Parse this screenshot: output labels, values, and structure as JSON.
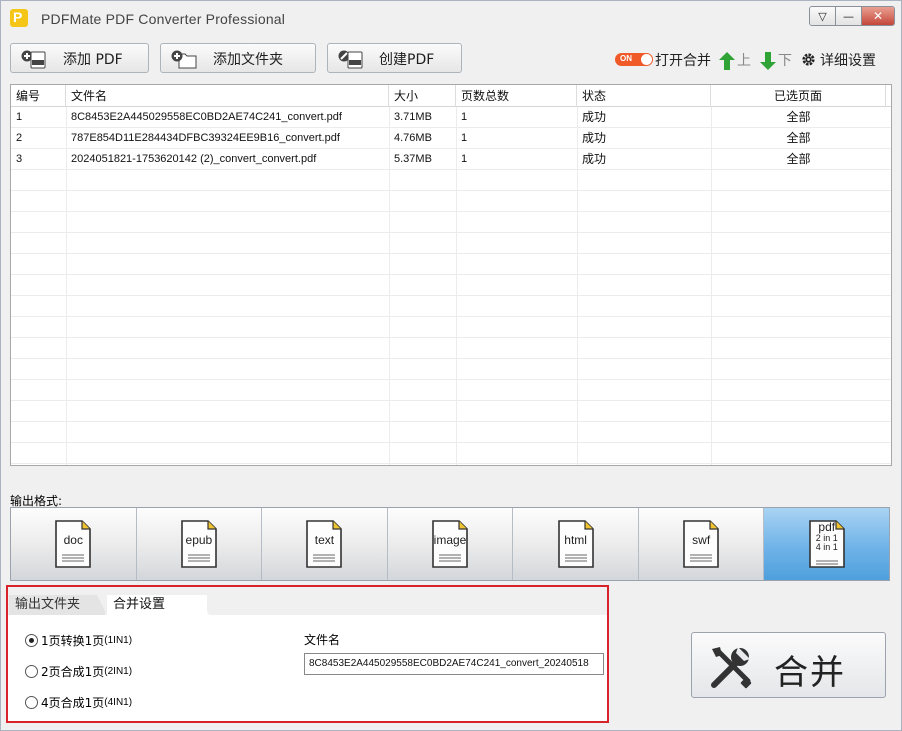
{
  "window": {
    "title": "PDFMate PDF Converter Professional",
    "controls": {
      "dropdown": "▽",
      "minimize": "—",
      "close": "✕"
    }
  },
  "toolbar": {
    "add_pdf": "添加 PDF",
    "add_folder": "添加文件夹",
    "create_pdf": "创建PDF",
    "toggle_text": "ON",
    "open_merge": "打开合并",
    "up": "上",
    "down": "下",
    "settings": "详细设置"
  },
  "table": {
    "columns": [
      "编号",
      "文件名",
      "大小",
      "页数总数",
      "状态",
      "已选页面"
    ],
    "rows": [
      {
        "id": "1",
        "name": "8C8453E2A445029558EC0BD2AE74C241_convert.pdf",
        "size": "3.71MB",
        "pages": "1",
        "status": "成功",
        "selected": "全部"
      },
      {
        "id": "2",
        "name": "787E854D11E284434DFBC39324EE9B16_convert.pdf",
        "size": "4.76MB",
        "pages": "1",
        "status": "成功",
        "selected": "全部"
      },
      {
        "id": "3",
        "name": "2024051821-1753620142 (2)_convert_convert.pdf",
        "size": "5.37MB",
        "pages": "1",
        "status": "成功",
        "selected": "全部"
      }
    ]
  },
  "output": {
    "label": "输出格式:",
    "formats": [
      {
        "key": "doc",
        "label": "doc"
      },
      {
        "key": "epub",
        "label": "epub"
      },
      {
        "key": "text",
        "label": "text"
      },
      {
        "key": "image",
        "label": "image"
      },
      {
        "key": "html",
        "label": "html"
      },
      {
        "key": "swf",
        "label": "swf"
      },
      {
        "key": "pdf",
        "label": "pdf",
        "sub1": "2 in 1",
        "sub2": "4 in 1"
      }
    ],
    "selected": "pdf"
  },
  "settings": {
    "tabs": [
      "输出文件夹",
      "合并设置"
    ],
    "active_tab": "合并设置",
    "options": [
      {
        "main": "1页转换1页",
        "suffix": "(1IN1)",
        "checked": true
      },
      {
        "main": "2页合成1页",
        "suffix": "(2IN1)",
        "checked": false
      },
      {
        "main": "4页合成1页",
        "suffix": "(4IN1)",
        "checked": false
      }
    ],
    "filename_label": "文件名",
    "filename_value": "8C8453E2A445029558EC0BD2AE74C241_convert_20240518"
  },
  "merge_button": {
    "label": "合并"
  },
  "colors": {
    "accent": "#4f9fdd",
    "highlight_frame": "#d8232a",
    "toggle": "#f05a28",
    "arrow": "#2fa336"
  }
}
